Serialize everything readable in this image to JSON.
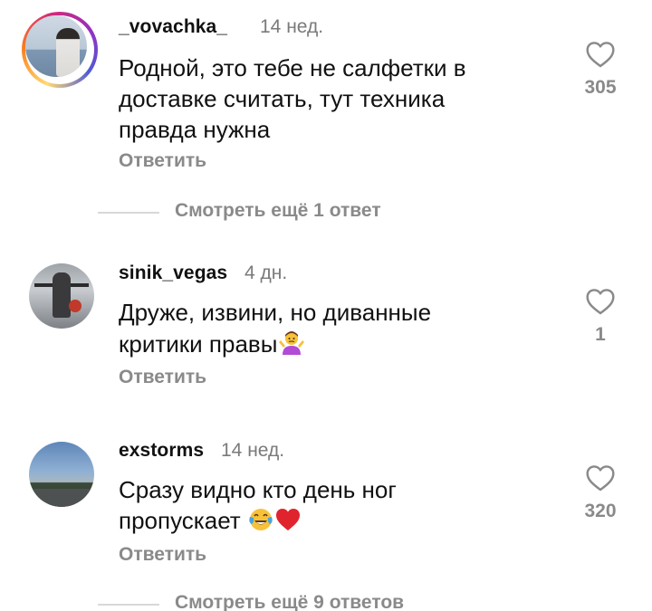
{
  "comments": [
    {
      "username": "_vovachka_",
      "time": "14 нед.",
      "text_lines": [
        "Родной, это тебе не салфетки в",
        "доставке считать, тут техника",
        "правда нужна"
      ],
      "reply_label": "Ответить",
      "like_count": "305",
      "has_story_ring": true,
      "more_replies": "Смотреть ещё 1 ответ"
    },
    {
      "username": "sinik_vegas",
      "time": "4 дн.",
      "text_lines": [
        "Друже, извини, но диванные",
        "критики правы"
      ],
      "emojis": [
        "person-shrugging"
      ],
      "reply_label": "Ответить",
      "like_count": "1",
      "has_story_ring": false
    },
    {
      "username": "exstorms",
      "time": "14 нед.",
      "text_lines": [
        "Сразу видно кто день ног",
        "пропускает"
      ],
      "emojis": [
        "face-with-tears-of-joy",
        "red-heart"
      ],
      "reply_label": "Ответить",
      "like_count": "320",
      "has_story_ring": false,
      "more_replies": "Смотреть ещё 9 ответов"
    }
  ],
  "colors": {
    "text": "#111111",
    "muted": "#8a8a8a",
    "divider": "#d8d8d8"
  },
  "icons": {
    "like": "heart-outline-icon"
  }
}
